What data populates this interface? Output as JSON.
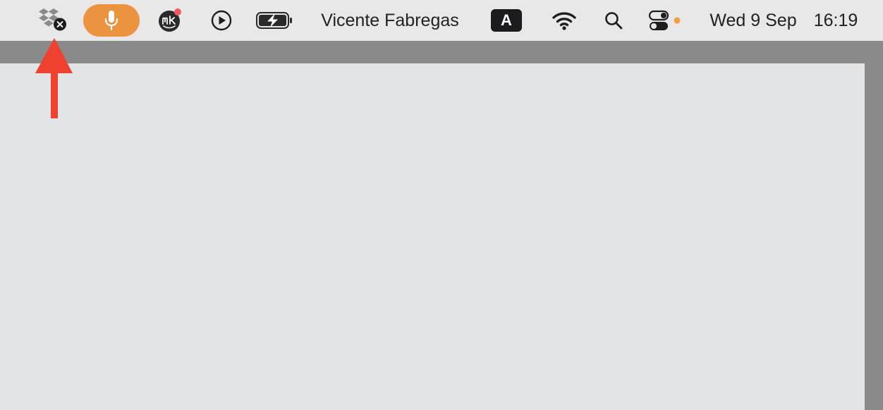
{
  "menubar": {
    "icons": {
      "dropbox": "dropbox-icon",
      "dropbox_status": "close-badge-icon",
      "microphone": "microphone-icon",
      "meetingkit": "mk-app-icon",
      "play": "play-circle-icon",
      "battery": "battery-charging-icon",
      "wifi": "wifi-icon",
      "search": "search-icon",
      "control_center": "toggle-switches-icon"
    },
    "user_name": "Vicente Fabregas",
    "input_source": "A",
    "date": "Wed 9 Sep",
    "time": "16:19"
  },
  "annotation": {
    "arrow": "up-arrow-icon"
  },
  "colors": {
    "menubar_bg": "#e8e8e8",
    "mic_pill": "#ec9340",
    "notification_dot": "#ef5b5b",
    "privacy_dot": "#f0a040",
    "arrow": "#ee4130",
    "window_bg": "#e3e4e6",
    "desktop_bg": "#8a8a8a",
    "badge_dark": "#1c1c1e"
  }
}
